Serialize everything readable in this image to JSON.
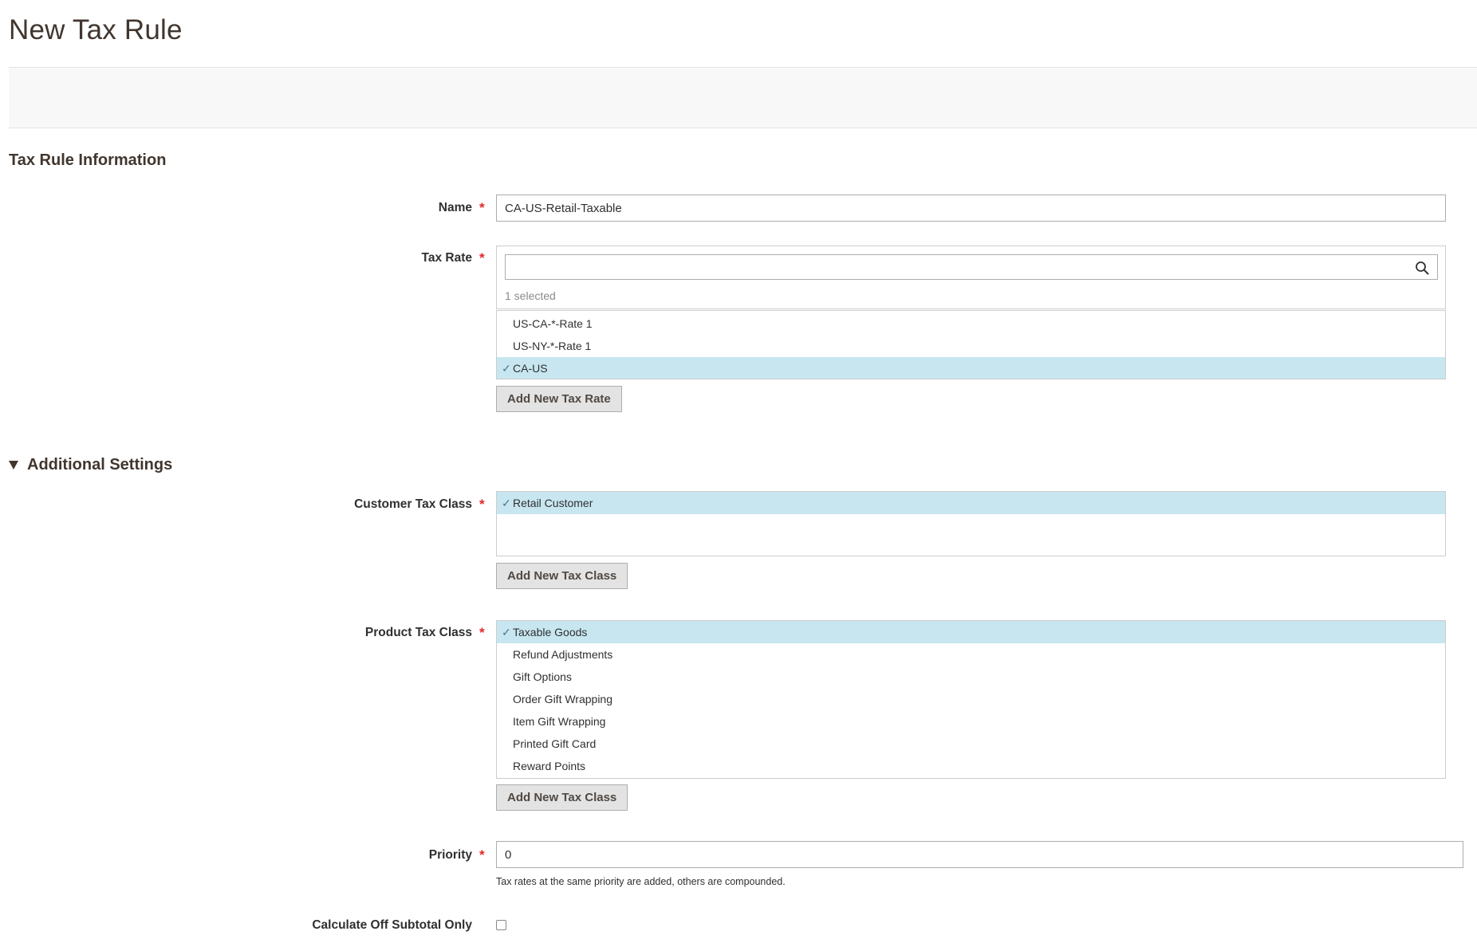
{
  "page": {
    "title": "New Tax Rule"
  },
  "tax_rule_information": {
    "section_title": "Tax Rule Information",
    "name": {
      "label": "Name",
      "required_mark": "*",
      "value": "CA-US-Retail-Taxable"
    },
    "tax_rate": {
      "label": "Tax Rate",
      "required_mark": "*",
      "search_value": "",
      "selected_count": "1 selected",
      "options": [
        {
          "label": "US-CA-*-Rate 1",
          "selected": false
        },
        {
          "label": "US-NY-*-Rate 1",
          "selected": false
        },
        {
          "label": "CA-US",
          "selected": true
        }
      ],
      "add_button_label": "Add New Tax Rate"
    }
  },
  "additional_settings": {
    "section_title": "Additional Settings",
    "customer_tax_class": {
      "label": "Customer Tax Class",
      "required_mark": "*",
      "options": [
        {
          "label": "Retail Customer",
          "selected": true
        }
      ],
      "add_button_label": "Add New Tax Class"
    },
    "product_tax_class": {
      "label": "Product Tax Class",
      "required_mark": "*",
      "options": [
        {
          "label": "Taxable Goods",
          "selected": true
        },
        {
          "label": "Refund Adjustments",
          "selected": false
        },
        {
          "label": "Gift Options",
          "selected": false
        },
        {
          "label": "Order Gift Wrapping",
          "selected": false
        },
        {
          "label": "Item Gift Wrapping",
          "selected": false
        },
        {
          "label": "Printed Gift Card",
          "selected": false
        },
        {
          "label": "Reward Points",
          "selected": false
        }
      ],
      "add_button_label": "Add New Tax Class"
    },
    "priority": {
      "label": "Priority",
      "required_mark": "*",
      "value": "0",
      "note": "Tax rates at the same priority are added, others are compounded."
    },
    "calculate_off_subtotal": {
      "label": "Calculate Off Subtotal Only",
      "checked": false
    }
  },
  "icons": {
    "search": "search-icon",
    "check": "check-icon",
    "collapse": "triangle-down-icon"
  },
  "colors": {
    "selected_option_bg": "#c7e6f0",
    "required_mark": "#e22626",
    "button_bg": "#e3e3e3"
  }
}
